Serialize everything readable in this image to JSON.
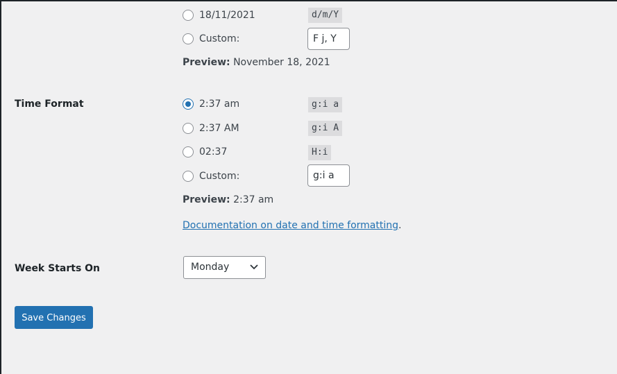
{
  "date_format": {
    "options": [
      {
        "label": "18/11/2021",
        "code": "d/m/Y",
        "checked": false
      }
    ],
    "custom_label": "Custom:",
    "custom_value": "F j, Y",
    "preview_label": "Preview:",
    "preview_value": "November 18, 2021"
  },
  "time_format": {
    "label": "Time Format",
    "options": [
      {
        "label": "2:37 am",
        "code": "g:i a",
        "checked": true
      },
      {
        "label": "2:37 AM",
        "code": "g:i A",
        "checked": false
      },
      {
        "label": "02:37",
        "code": "H:i",
        "checked": false
      }
    ],
    "custom_label": "Custom:",
    "custom_value": "g:i a",
    "preview_label": "Preview:",
    "preview_value": "2:37 am"
  },
  "documentation": {
    "link_text": "Documentation on date and time formatting",
    "trailing": "."
  },
  "week_starts_on": {
    "label": "Week Starts On",
    "selected": "Monday"
  },
  "save_button": {
    "label": "Save Changes"
  },
  "colors": {
    "accent": "#2271b1",
    "background": "#f0f0f1"
  }
}
